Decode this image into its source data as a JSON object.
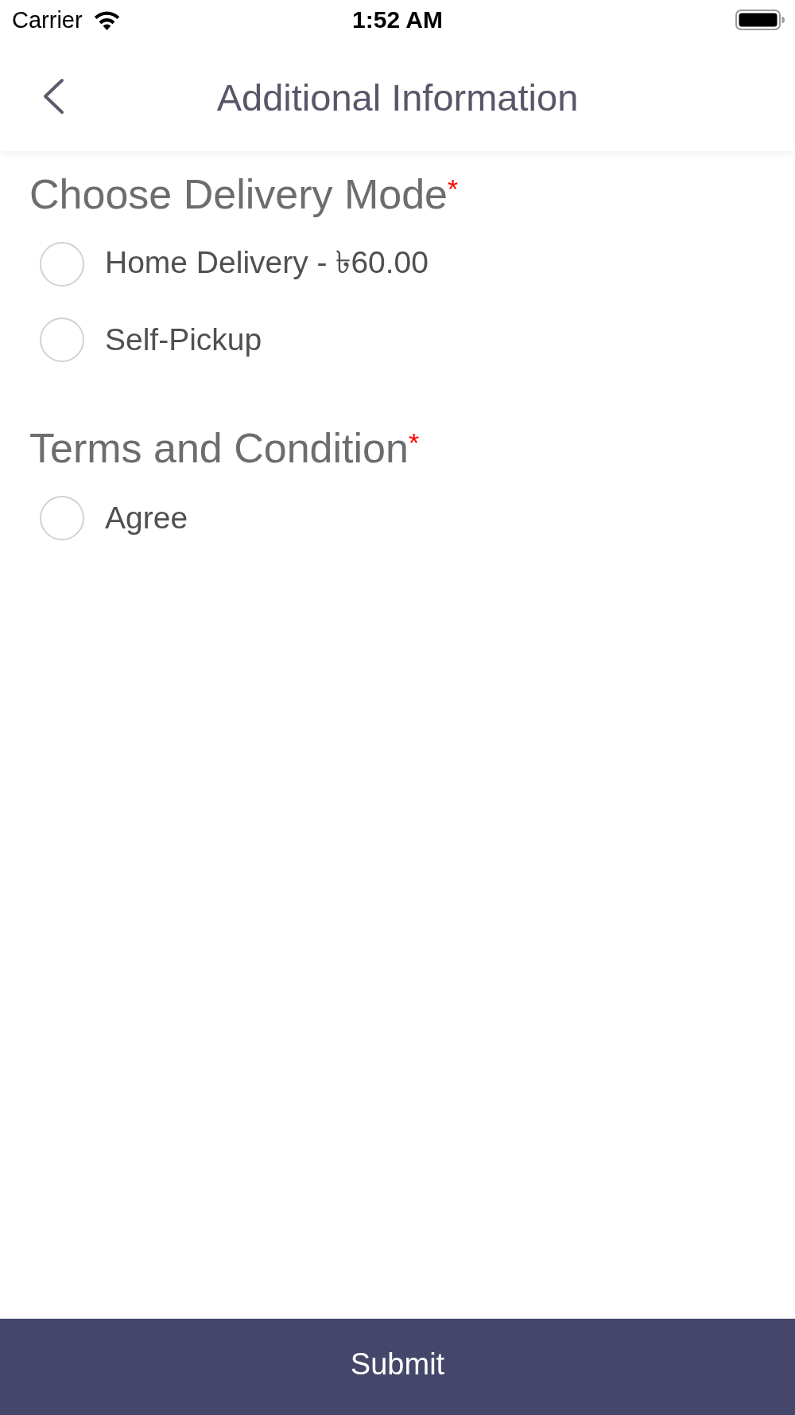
{
  "status_bar": {
    "carrier": "Carrier",
    "time": "1:52 AM"
  },
  "nav_bar": {
    "title": "Additional Information"
  },
  "sections": [
    {
      "title": "Choose Delivery Mode",
      "required_mark": "*",
      "options": [
        {
          "label": "Home Delivery - ৳60.00",
          "selected": false
        },
        {
          "label": "Self-Pickup",
          "selected": false
        }
      ]
    },
    {
      "title": "Terms and Condition",
      "required_mark": "*",
      "options": [
        {
          "label": "Agree",
          "selected": false
        }
      ]
    }
  ],
  "submit_button": {
    "label": "Submit"
  }
}
